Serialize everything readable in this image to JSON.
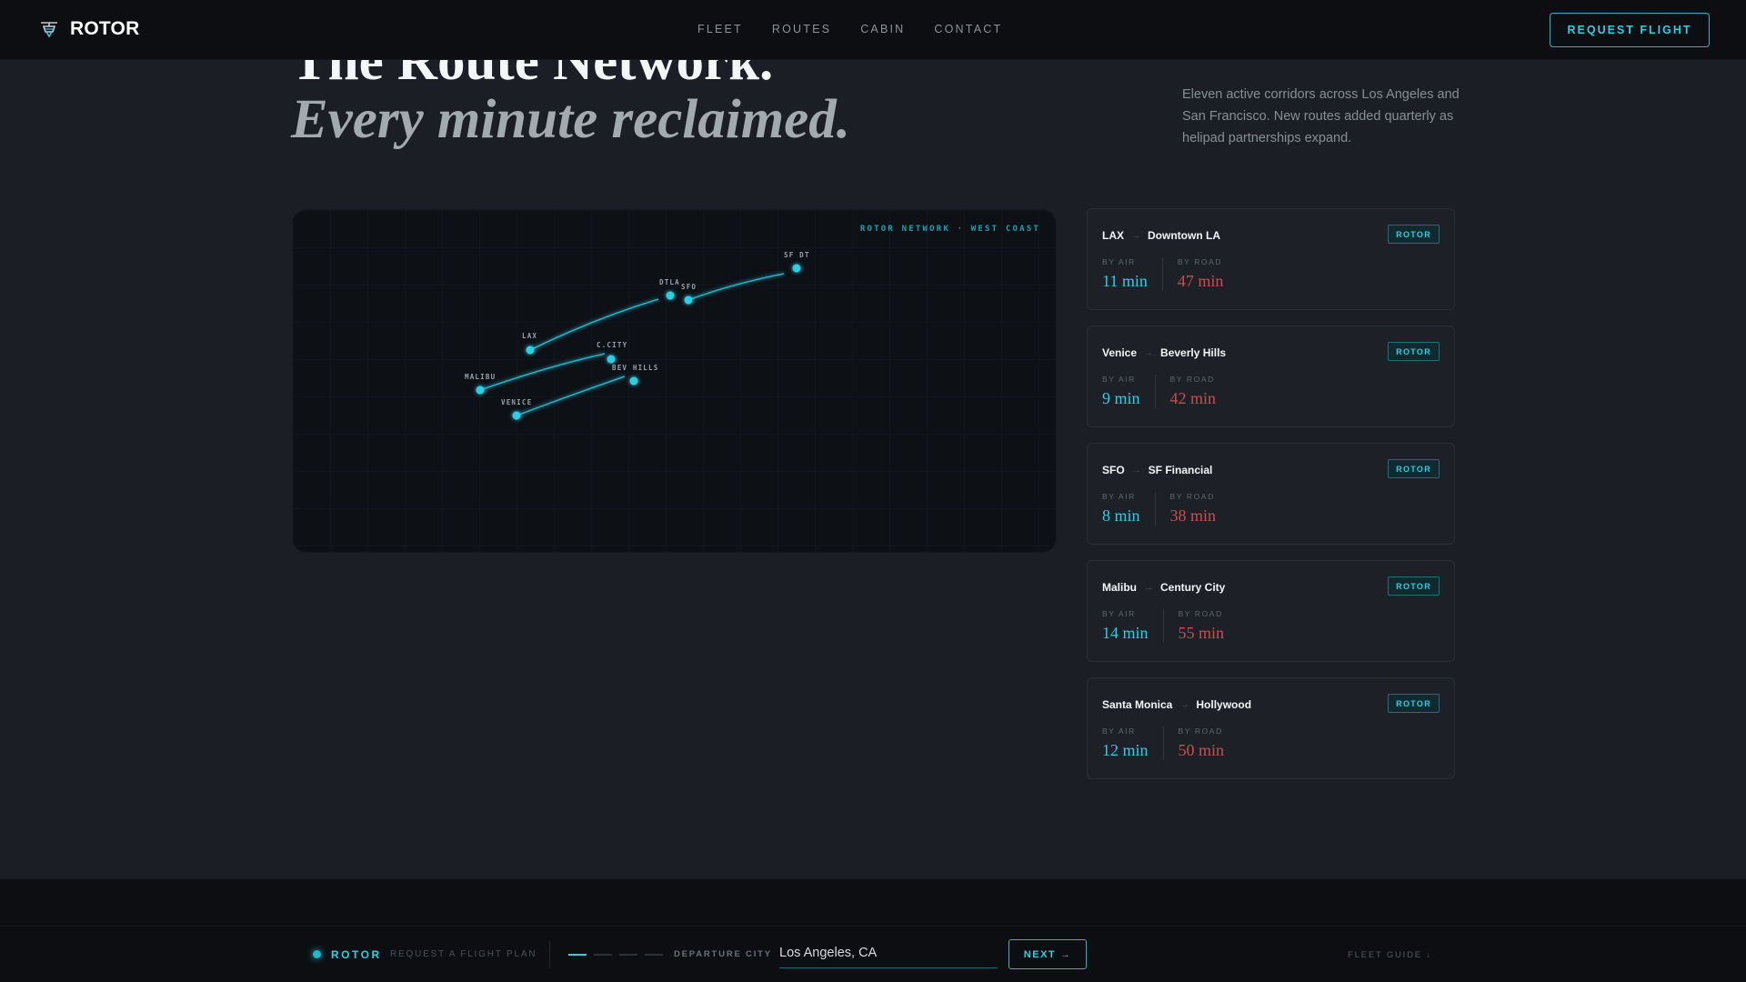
{
  "nav": {
    "brand": "ROTOR",
    "links": [
      "FLEET",
      "ROUTES",
      "CABIN",
      "CONTACT"
    ],
    "cta": "REQUEST FLIGHT"
  },
  "hero": {
    "title": "The Route Network.",
    "subtitle": "Every minute reclaimed.",
    "description": "Eleven active corridors across Los Angeles and San Francisco. New routes added quarterly as helipad partnerships expand."
  },
  "map": {
    "label": "ROTOR NETWORK · WEST COAST",
    "accent_color": "#2ccfe6",
    "cities": [
      "SF DT",
      "DTLA",
      "SFO",
      "LAX",
      "C.CITY",
      "MALIBU",
      "BEV HILLS",
      "VENICE"
    ]
  },
  "routes": [
    {
      "from": "LAX",
      "to": "Downtown LA",
      "badge": "ROTOR",
      "air_label": "BY AIR",
      "air": "11 min",
      "road_label": "BY ROAD",
      "road": "47 min"
    },
    {
      "from": "Venice",
      "to": "Beverly Hills",
      "badge": "ROTOR",
      "air_label": "BY AIR",
      "air": "9 min",
      "road_label": "BY ROAD",
      "road": "42 min"
    },
    {
      "from": "SFO",
      "to": "SF Financial",
      "badge": "ROTOR",
      "air_label": "BY AIR",
      "air": "8 min",
      "road_label": "BY ROAD",
      "road": "38 min"
    },
    {
      "from": "Malibu",
      "to": "Century City",
      "badge": "ROTOR",
      "air_label": "BY AIR",
      "air": "14 min",
      "road_label": "BY ROAD",
      "road": "55 min"
    },
    {
      "from": "Santa Monica",
      "to": "Hollywood",
      "badge": "ROTOR",
      "air_label": "BY AIR",
      "air": "12 min",
      "road_label": "BY ROAD",
      "road": "50 min"
    }
  ],
  "route_arrow": "→",
  "footer": {
    "brand": "ROTOR",
    "step_label": "REQUEST A FLIGHT PLAN",
    "field_label": "DEPARTURE CITY",
    "field_value": "Los Angeles, CA",
    "next_label": "NEXT →",
    "guide_label": "FLEET GUIDE ↓",
    "progress": {
      "current_step": 1,
      "total_steps": 4
    }
  }
}
